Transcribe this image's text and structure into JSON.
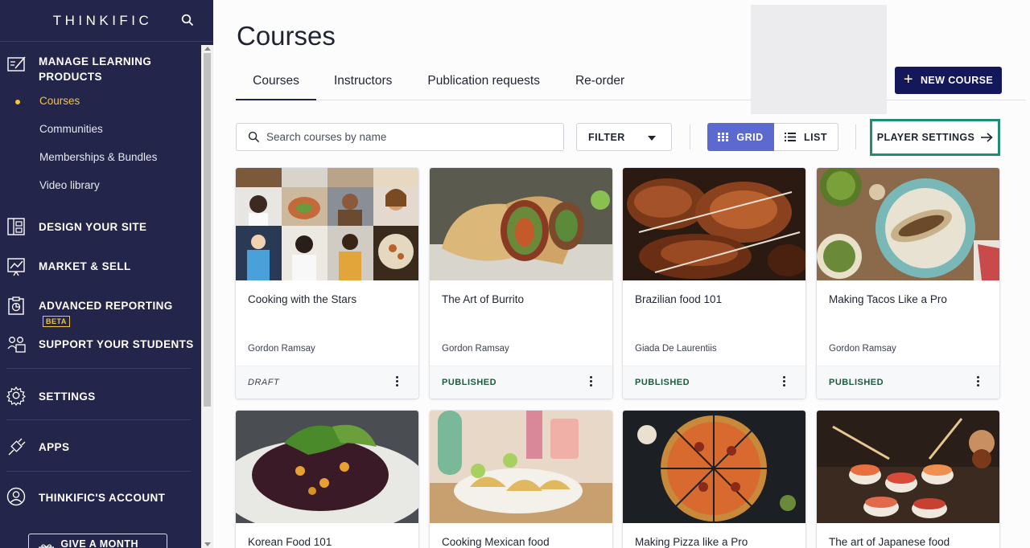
{
  "sidebar": {
    "logo": "THINKIFIC",
    "sections": [
      {
        "label": "MANAGE LEARNING PRODUCTS",
        "icon": "manage-learning-icon"
      },
      {
        "label": "DESIGN YOUR SITE",
        "icon": "design-site-icon"
      },
      {
        "label": "MARKET & SELL",
        "icon": "market-sell-icon"
      },
      {
        "label": "ADVANCED REPORTING",
        "icon": "reporting-icon",
        "badge": "BETA"
      },
      {
        "label": "SUPPORT YOUR STUDENTS",
        "icon": "support-students-icon"
      },
      {
        "label": "SETTINGS",
        "icon": "settings-icon"
      },
      {
        "label": "APPS",
        "icon": "apps-icon"
      },
      {
        "label": "THINKIFIC'S ACCOUNT",
        "icon": "account-icon"
      }
    ],
    "subitems": [
      "Courses",
      "Communities",
      "Memberships & Bundles",
      "Video library"
    ],
    "give_button": "GIVE A MONTH FREE",
    "accent_color": "#f5c53b",
    "bg_color": "#23254a"
  },
  "main": {
    "title": "Courses",
    "tabs": [
      "Courses",
      "Instructors",
      "Publication requests",
      "Re-order"
    ],
    "new_course": "NEW COURSE",
    "search_placeholder": "Search courses by name",
    "filter": "FILTER",
    "grid": "GRID",
    "list": "LIST",
    "player_settings": "PLAYER SETTINGS",
    "primary_color": "#14185a",
    "active_view_color": "#5c6ad0",
    "highlight_color": "#1e8f72"
  },
  "courses": [
    {
      "title": "Cooking with the Stars",
      "author": "Gordon Ramsay",
      "status": "DRAFT"
    },
    {
      "title": "The Art of Burrito",
      "author": "Gordon Ramsay",
      "status": "PUBLISHED"
    },
    {
      "title": "Brazilian food 101",
      "author": "Giada De Laurentiis",
      "status": "PUBLISHED"
    },
    {
      "title": "Making Tacos Like a Pro",
      "author": "Gordon Ramsay",
      "status": "PUBLISHED"
    },
    {
      "title": "Korean Food 101"
    },
    {
      "title": "Cooking Mexican food"
    },
    {
      "title": "Making Pizza like a Pro"
    },
    {
      "title": "The art of Japanese food"
    }
  ]
}
